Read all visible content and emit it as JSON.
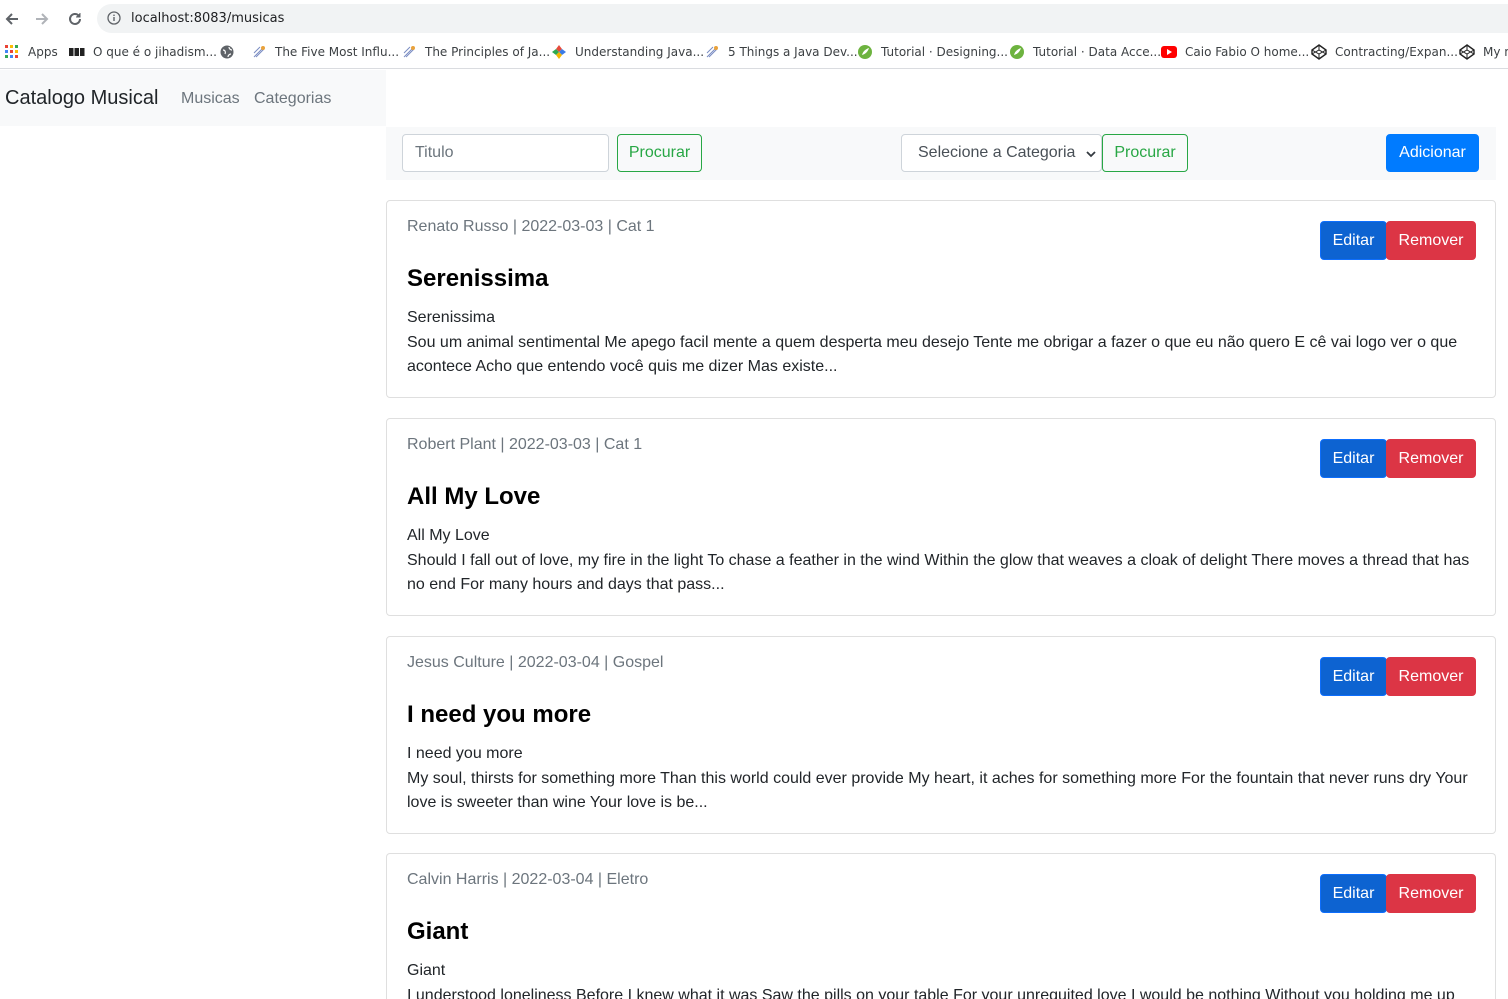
{
  "browser": {
    "url": "localhost:8083/musicas",
    "bookmarks": [
      {
        "label": "Apps",
        "icon": "apps-grid-icon"
      },
      {
        "label": "O que é o jihadism...",
        "icon": "bbc-icon"
      },
      {
        "label": "",
        "icon": "globe-icon"
      },
      {
        "label": "The Five Most Influ...",
        "icon": "java-icon"
      },
      {
        "label": "The Principles of Ja...",
        "icon": "java-icon"
      },
      {
        "label": "Understanding Java...",
        "icon": "puzzle-icon"
      },
      {
        "label": "5 Things a Java Dev...",
        "icon": "java-icon"
      },
      {
        "label": "Tutorial · Designing...",
        "icon": "spring-icon"
      },
      {
        "label": "Tutorial · Data Acce...",
        "icon": "spring-icon"
      },
      {
        "label": "Caio Fabio O home...",
        "icon": "youtube-icon"
      },
      {
        "label": "Contracting/Expan...",
        "icon": "codepen-icon"
      },
      {
        "label": "My n",
        "icon": "codepen-icon"
      }
    ]
  },
  "navbar": {
    "brand": "Catalogo Musical",
    "links": [
      "Musicas",
      "Categorias"
    ]
  },
  "search": {
    "title_placeholder": "Titulo",
    "search_label": "Procurar",
    "category_placeholder": "Selecione a Categoria",
    "search_category_label": "Procurar",
    "add_label": "Adicionar"
  },
  "cards": [
    {
      "meta": "Renato Russo | 2022-03-03 | Cat 1",
      "title": "Serenissima",
      "subtitle": "Serenissima",
      "text": "Sou um animal sentimental Me apego facil mente a quem desperta meu desejo Tente me obrigar a fazer o que eu não quero E cê vai logo ver o que acontece Acho que entendo você quis me dizer Mas existe...",
      "edit_label": "Editar",
      "remove_label": "Remover"
    },
    {
      "meta": "Robert Plant | 2022-03-03 | Cat 1",
      "title": "All My Love",
      "subtitle": "All My Love",
      "text": "Should I fall out of love, my fire in the light To chase a feather in the wind Within the glow that weaves a cloak of delight There moves a thread that has no end For many hours and days that pass...",
      "edit_label": "Editar",
      "remove_label": "Remover"
    },
    {
      "meta": "Jesus Culture | 2022-03-04 | Gospel",
      "title": "I need you more",
      "subtitle": "I need you more",
      "text": "My soul, thirsts for something more Than this world could ever provide My heart, it aches for something more For the fountain that never runs dry Your love is sweeter than wine Your love is be...",
      "edit_label": "Editar",
      "remove_label": "Remover"
    },
    {
      "meta": "Calvin Harris | 2022-03-04 | Eletro",
      "title": "Giant",
      "subtitle": "Giant",
      "text": "I understood loneliness Before I knew what it was Saw the pills on your table For your unrequited love I would be nothing Without you holding me up",
      "edit_label": "Editar",
      "remove_label": "Remover"
    }
  ],
  "colors": {
    "primary": "#007bff",
    "danger": "#dc3545",
    "success": "#28a745",
    "navbar_bg": "#f8f9fa"
  }
}
